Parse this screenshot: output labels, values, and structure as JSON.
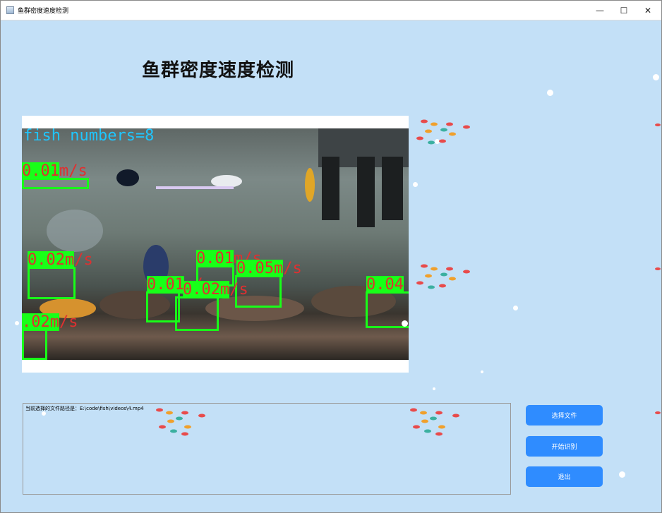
{
  "window": {
    "title": "鱼群密度速度检测",
    "controls": {
      "minimize": "—",
      "maximize": "☐",
      "close": "✕"
    }
  },
  "heading": "鱼群密度速度检测",
  "video": {
    "fish_count_label": "fish numbers=8",
    "speed_labels": [
      {
        "hl": "0.01",
        "rest": "m/s"
      },
      {
        "hl": "0.02m",
        "rest": "/s"
      },
      {
        "hl": "0.01",
        "rest": "m/s"
      },
      {
        "hl": "0.05m",
        "rest": "/s"
      },
      {
        "hl": "0.01",
        "rest": "m/s"
      },
      {
        "hl": "0.02m",
        "rest": "/s"
      },
      {
        "hl": ".02m",
        "rest": "/s"
      },
      {
        "hl": "0.04",
        "rest": ""
      }
    ]
  },
  "log": {
    "text": "当前选择的文件路径是：E:\\code\\fish\\videos\\4.mp4"
  },
  "buttons": {
    "select_file": "选择文件",
    "start": "开始识别",
    "exit": "退出"
  },
  "colors": {
    "background": "#c3e0f7",
    "button": "#2f8cff",
    "detection_box": "#18ff18",
    "speed_text": "#e03030",
    "count_text": "#1fc6ff"
  }
}
